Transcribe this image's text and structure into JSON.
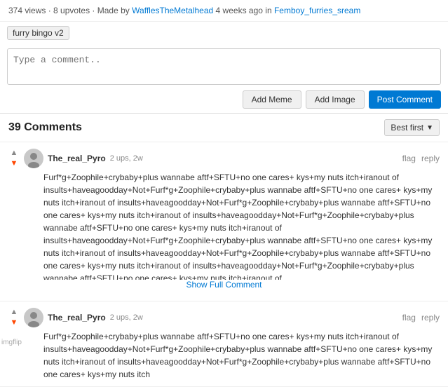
{
  "meta": {
    "views": "374 views",
    "upvotes": "8 upvotes",
    "made_by_label": "Made by",
    "author": "WafflesTheMetalhead",
    "time": "4 weeks ago",
    "in_label": "in",
    "community": "Femboy_furries_sream"
  },
  "tag": {
    "label": "furry bingo v2"
  },
  "comment_box": {
    "placeholder": "Type a comment..",
    "btn_meme": "Add Meme",
    "btn_image": "Add Image",
    "btn_post": "Post Comment"
  },
  "comments_section": {
    "title": "39 Comments",
    "sort_label": "Best first",
    "sort_arrow": "▼"
  },
  "comments": [
    {
      "id": 1,
      "username": "The_real_Pyro",
      "ups": "2 ups",
      "time": "2w",
      "downvoted": true,
      "text": "Furf*g+Zoophile+crybaby+plus wannabe aftf+SFTU+no one cares+ kys+my nuts itch+iranout of insults+haveagoodday+Not+Furf*g+Zoophile+crybaby+plus wannabe aftf+SFTU+no one cares+ kys+my nuts itch+iranout of insults+haveagoodday+Not+Furf*g+Zoophile+crybaby+plus wannabe aftf+SFTU+no one cares+ kys+my nuts itch+iranout of insults+haveagoodday+Not+Furf*g+Zoophile+crybaby+plus wannabe aftf+SFTU+no one cares+ kys+my nuts itch+iranout of insults+haveagoodday+Not+Furf*g+Zoophile+crybaby+plus wannabe aftf+SFTU+no one cares+ kys+my nuts itch+iranout of insults+haveagoodday+Not+Furf*g+Zoophile+crybaby+plus wannabe aftf+SFTU+no one cares+ kys+my nuts itch+iranout of insults+haveagoodday+Not+Furf*g+Zoophile+crybaby+plus wannabe aftf+SFTU+no one cares+ kys+my nuts itch+iranout of",
      "show_full": "Show Full Comment",
      "truncated": true
    },
    {
      "id": 2,
      "username": "The_real_Pyro",
      "ups": "2 ups",
      "time": "2w",
      "downvoted": true,
      "text": "Furf*g+Zoophile+crybaby+plus wannabe aftf+SFTU+no one cares+ kys+my nuts itch+iranout of insults+haveagoodday+Not+Furf*g+Zoophile+crybaby+plus wannabe aftf+SFTU+no one cares+ kys+my nuts itch+iranout of insults+haveagoodday+Not+Furf*g+Zoophile+crybaby+plus wannabe aftf+SFTU+no one cares+ kys+my nuts itch",
      "show_full": null,
      "truncated": false
    }
  ],
  "labels": {
    "flag": "flag",
    "reply": "reply"
  },
  "imgflip": "imgflip"
}
